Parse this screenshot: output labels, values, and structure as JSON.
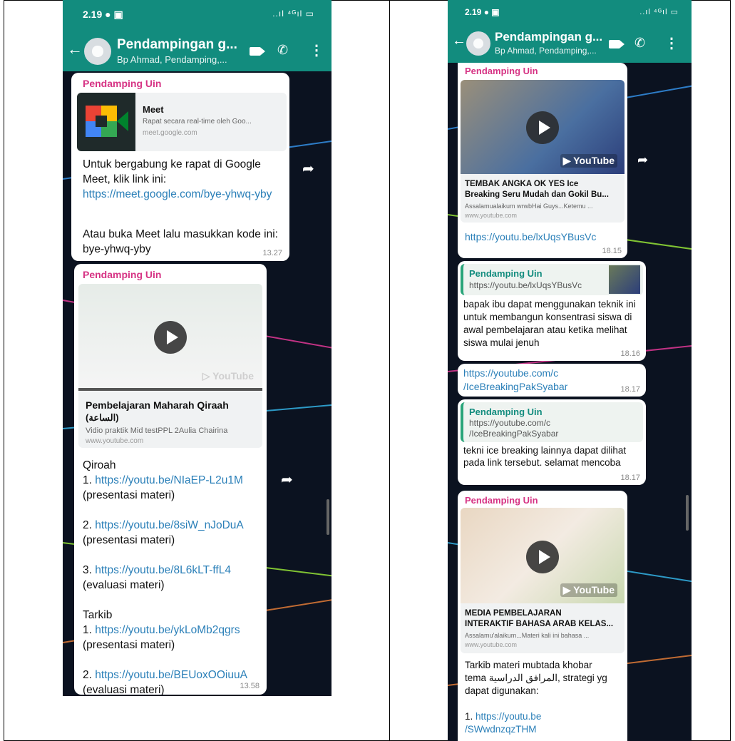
{
  "left": {
    "status": {
      "time": "2.19 ● ▣",
      "icons": "..ıl ⁴ᴳıl ▭"
    },
    "header": {
      "title": "Pendampingan g...",
      "subtitle": "Bp Ahmad, Pendamping,..."
    },
    "msg1": {
      "sender": "Pendamping Uin",
      "card_title": "Meet",
      "card_desc": "Rapat secara real-time oleh Goo...",
      "card_domain": "meet.google.com",
      "text1": "Untuk bergabung ke rapat di Google Meet, klik link ini:",
      "link": "https://meet.google.com/bye-yhwq-yby",
      "text2": "Atau buka Meet lalu masukkan kode ini: bye-yhwq-yby",
      "time": "13.27"
    },
    "msg2": {
      "sender": "Pendamping Uin",
      "yt_badge": "▷ YouTube",
      "card_title": "Pembelajaran Maharah Qiraah",
      "card_title2": "(الساعة)",
      "card_desc": "Vidio praktik Mid testPPL 2Aulia Chairina",
      "card_domain": "www.youtube.com",
      "section1": "Qiroah",
      "items": [
        {
          "num": "1. ",
          "link": "https://youtu.be/NIaEP-L2u1M",
          "note": "(presentasi materi)"
        },
        {
          "num": "2. ",
          "link": "https://youtu.be/8siW_nJoDuA",
          "note": "(presentasi materi)"
        },
        {
          "num": "3. ",
          "link": "https://youtu.be/8L6kLT-ffL4",
          "note": "(evaluasi materi)"
        }
      ],
      "section2": "Tarkib",
      "items2": [
        {
          "num": "1. ",
          "link": "https://youtu.be/ykLoMb2qgrs",
          "note": " (presentasi materi)"
        },
        {
          "num": "2. ",
          "link": "https://youtu.be/BEUoxOOiuuA",
          "note": "(evaluasi materi)"
        }
      ],
      "time": "13.58"
    }
  },
  "right": {
    "status": {
      "time": "2.19 ● ▣",
      "icons": "..ıl ⁴ᴳıl ▭"
    },
    "header": {
      "title": "Pendampingan g...",
      "subtitle": "Bp Ahmad, Pendamping,..."
    },
    "msg1": {
      "sender": "Pendamping Uin",
      "yt_badge": "▶ YouTube",
      "card_title1": "TEMBAK ANGKA OK YES Ice",
      "card_title2": "Breaking Seru Mudah dan Gokil Bu...",
      "card_desc": "Assalamualaikum wrwbHai Guys...Ketemu ...",
      "card_domain": "www.youtube.com",
      "link": "https://youtu.be/lxUqsYBusVc",
      "time": "18.15"
    },
    "msg2": {
      "quote_sender": "Pendamping Uin",
      "quote_text": "https://youtu.be/lxUqsYBusVc",
      "text": "bapak ibu dapat menggunakan teknik ini untuk membangun konsentrasi siswa di awal pembelajaran atau ketika melihat siswa mulai jenuh",
      "time": "18.16"
    },
    "msg3": {
      "link1": "https://youtube.com/c",
      "link2": "/IceBreakingPakSyabar",
      "time": "18.17"
    },
    "msg4": {
      "quote_sender": "Pendamping Uin",
      "quote_text1": "https://youtube.com/c",
      "quote_text2": "/IceBreakingPakSyabar",
      "text": "tekni ice breaking lainnya dapat dilihat pada link tersebut. selamat mencoba",
      "time": "18.17"
    },
    "msg5": {
      "sender": "Pendamping Uin",
      "yt_badge": "▶ YouTube",
      "card_title1": "MEDIA PEMBELAJARAN",
      "card_title2": "INTERAKTIF BAHASA ARAB KELAS...",
      "card_desc": "Assalamu'alaikum...Materi kali ini bahasa ...",
      "card_domain": "www.youtube.com",
      "text1": "Tarkib materi mubtada khobar",
      "text2": "tema المرافق الدراسية, strategi yg",
      "text3": "dapat digunakan:",
      "link_num": "1. ",
      "link1": "https://youtu.be",
      "link2": "/SWwdnzqzTHM"
    }
  }
}
